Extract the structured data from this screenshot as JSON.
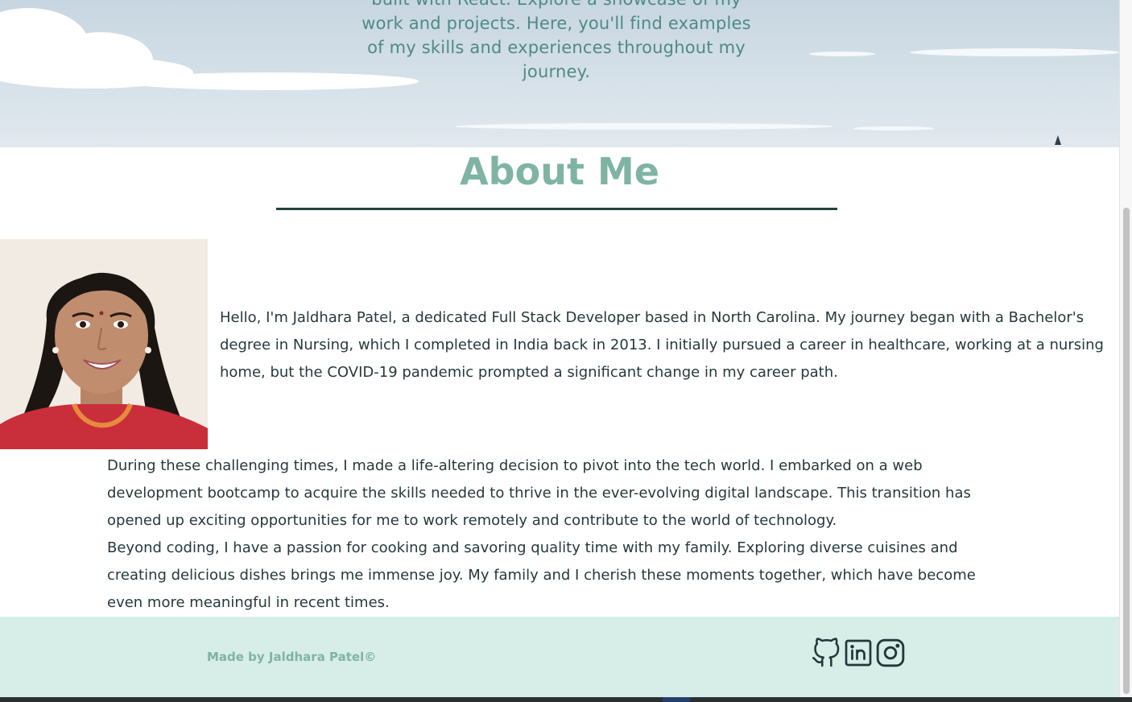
{
  "hero": {
    "intro_text": "built with React. Explore a showcase of my work and projects. Here, you'll find examples of my skills and experiences throughout my journey."
  },
  "about": {
    "title": "About Me",
    "photo_alt": "Portrait of Jaldhara Patel",
    "paragraphs": [
      "Hello, I'm Jaldhara Patel, a dedicated Full Stack Developer based in North Carolina. My journey began with a Bachelor's degree in Nursing, which I completed in India back in 2013. I initially pursued a career in healthcare, working at a nursing home, but the COVID-19 pandemic prompted a significant change in my career path.",
      "During these challenging times, I made a life-altering decision to pivot into the tech world. I embarked on a web development bootcamp to acquire the skills needed to thrive in the ever-evolving digital landscape. This transition has opened up exciting opportunities for me to work remotely and contribute to the world of technology.",
      "Beyond coding, I have a passion for cooking and savoring quality time with my family. Exploring diverse cuisines and creating delicious dishes brings me immense joy. My family and I cherish these moments together, which have become even more meaningful in recent times."
    ]
  },
  "footer": {
    "credit": "Made by Jaldhara Patel©",
    "social_links": [
      {
        "icon": "github-icon"
      },
      {
        "icon": "linkedin-icon"
      },
      {
        "icon": "instagram-icon"
      }
    ]
  },
  "colors": {
    "accent": "#7fb4a4",
    "heading_rule": "#23413f",
    "footer_bg": "#d6ede8",
    "body_text": "#26393c",
    "hero_text": "#4e8a86"
  }
}
